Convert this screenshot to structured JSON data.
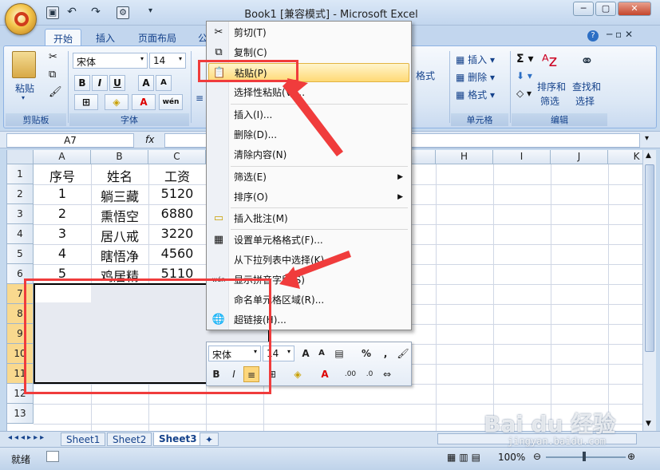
{
  "window": {
    "title": "Book1  [兼容模式] - Microsoft Excel",
    "minimize": "─",
    "restore": "▢",
    "close": "✕"
  },
  "ribbon": {
    "tabs": [
      "开始",
      "插入",
      "页面布局",
      "公"
    ],
    "font_name": "宋体",
    "font_size": "14",
    "paste_label": "粘贴",
    "group_clipboard": "剪贴板",
    "group_font": "字体",
    "group_cells": "单元格",
    "group_edit": "编辑",
    "insert_label": "插入",
    "delete_label": "删除",
    "format_label": "格式",
    "cond_format_label": "格式",
    "sort_filter_label": "排序和\n筛选",
    "find_select_label": "查找和\n选择",
    "sort_label_top": "排序和",
    "sort_label_bottom": "筛选",
    "find_label_top": "查找和",
    "find_label_bottom": "选择",
    "bold": "B",
    "italic": "I",
    "underline": "U",
    "wen": "wén"
  },
  "formula_bar": {
    "name_box": "A7",
    "fx": "fx"
  },
  "grid": {
    "columns": [
      "A",
      "B",
      "C",
      "H",
      "I",
      "J",
      "K"
    ],
    "rows": [
      "1",
      "2",
      "3",
      "4",
      "5",
      "6",
      "7",
      "8",
      "9",
      "10",
      "11",
      "12",
      "13"
    ],
    "headers": [
      "序号",
      "姓名",
      "工资"
    ],
    "data": [
      [
        "1",
        "躺三藏",
        "5120"
      ],
      [
        "2",
        "熏悟空",
        "6880"
      ],
      [
        "3",
        "居八戒",
        "3220"
      ],
      [
        "4",
        "瞎悟净",
        "4560"
      ],
      [
        "5",
        "鸡居精",
        "5110"
      ]
    ]
  },
  "context_menu": {
    "items": [
      {
        "label": "剪切(T)",
        "icon": "cut-icon"
      },
      {
        "label": "复制(C)",
        "icon": "copy-icon"
      },
      {
        "label": "粘贴(P)",
        "icon": "paste-icon"
      },
      {
        "label": "选择性粘贴(V)...",
        "icon": ""
      },
      {
        "label": "插入(I)...",
        "icon": ""
      },
      {
        "label": "删除(D)...",
        "icon": ""
      },
      {
        "label": "清除内容(N)",
        "icon": ""
      },
      {
        "label": "筛选(E)",
        "icon": ""
      },
      {
        "label": "排序(O)",
        "icon": ""
      },
      {
        "label": "插入批注(M)",
        "icon": "comment-icon"
      },
      {
        "label": "设置单元格格式(F)...",
        "icon": "format-cells-icon"
      },
      {
        "label": "从下拉列表中选择(K)...",
        "icon": ""
      },
      {
        "label": "显示拼音字段(S)",
        "icon": "phonetic-icon"
      },
      {
        "label": "命名单元格区域(R)...",
        "icon": ""
      },
      {
        "label": "超链接(H)...",
        "icon": "hyperlink-icon"
      }
    ]
  },
  "mini_toolbar": {
    "font_name": "宋体",
    "font_size": "14",
    "percent": "%",
    "comma": ",",
    "bold": "B",
    "italic": "I"
  },
  "sheets": [
    "Sheet1",
    "Sheet2",
    "Sheet3"
  ],
  "status": {
    "ready": "就绪",
    "zoom": "100%"
  },
  "watermark": {
    "brand": "Bai du 经验",
    "url": "jingyan.baidu.com"
  },
  "colors": {
    "annotation": "#f03c3c",
    "menu_highlight": "#ffd975"
  }
}
